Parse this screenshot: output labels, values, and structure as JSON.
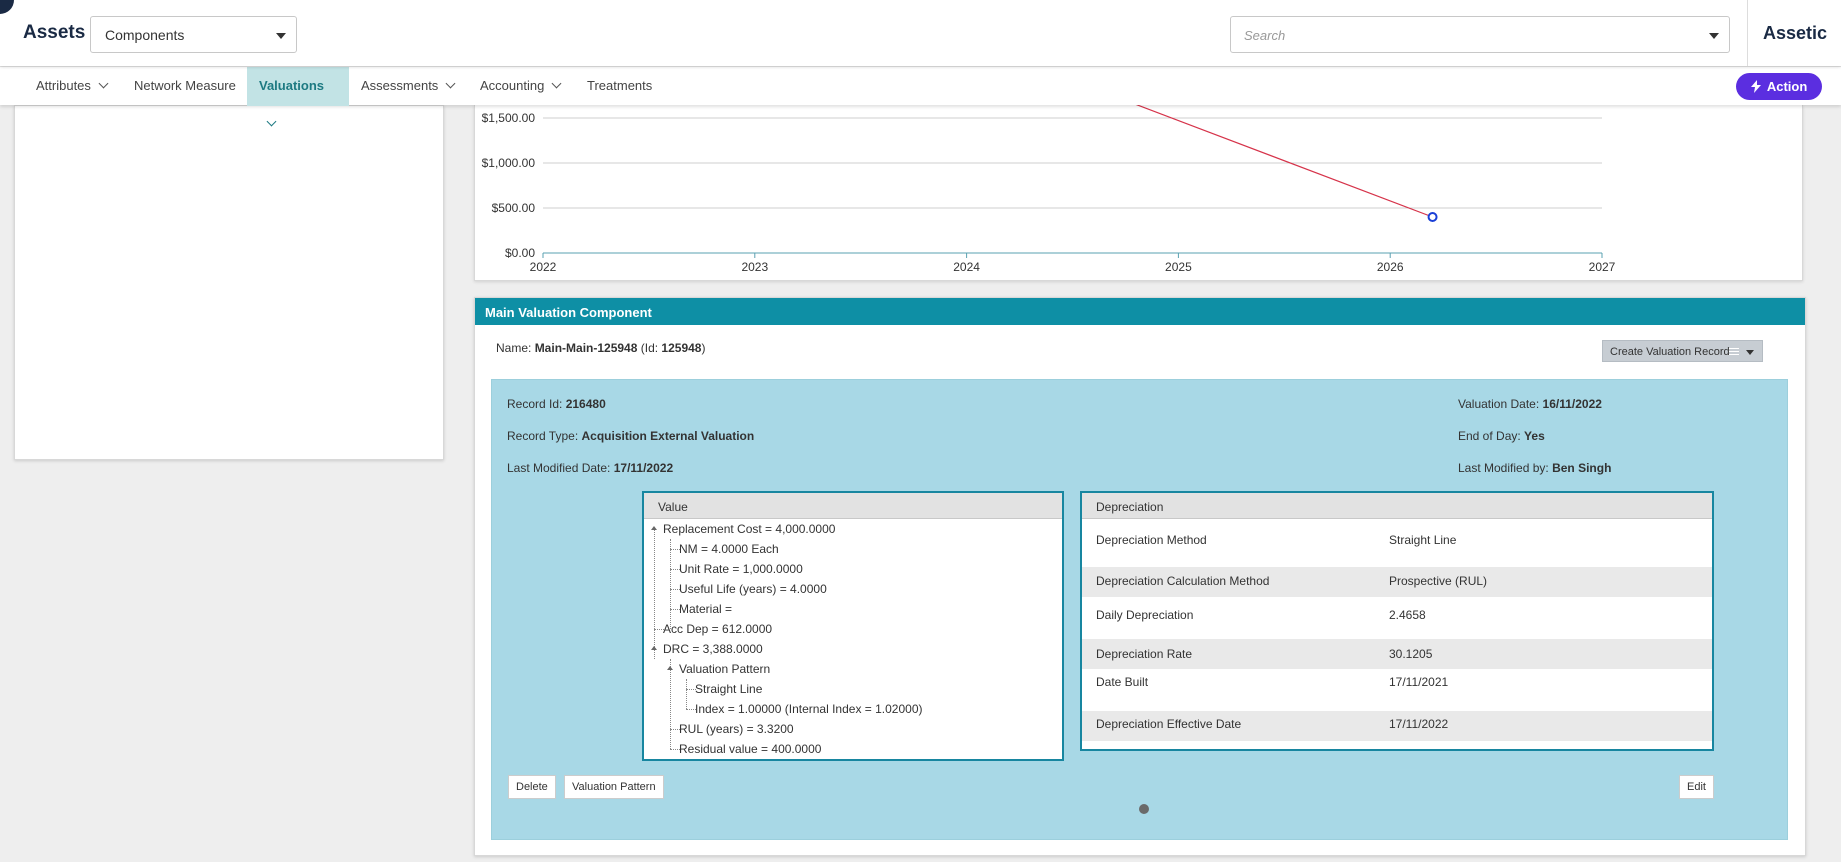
{
  "header": {
    "app_title": "Assets",
    "module_select": "Components",
    "search_placeholder": "Search",
    "brand": "Assetic"
  },
  "nav": {
    "items": [
      {
        "label": "Attributes",
        "has_dropdown": true,
        "active": false
      },
      {
        "label": "Network Measure",
        "has_dropdown": false,
        "active": false
      },
      {
        "label": "Valuations",
        "has_dropdown": true,
        "active": true
      },
      {
        "label": "Assessments",
        "has_dropdown": true,
        "active": false
      },
      {
        "label": "Accounting",
        "has_dropdown": true,
        "active": false
      },
      {
        "label": "Treatments",
        "has_dropdown": false,
        "active": false
      }
    ],
    "action_label": "Action"
  },
  "chart_data": {
    "type": "line",
    "title": "",
    "xlabel": "",
    "ylabel": "",
    "x_ticks": [
      "2022",
      "2023",
      "2024",
      "2025",
      "2026",
      "2027"
    ],
    "y_ticks": [
      "$0.00",
      "$500.00",
      "$1,000.00",
      "$1,500.00"
    ],
    "xlim": [
      2022,
      2027
    ],
    "series": [
      {
        "x": [
          2024.8,
          2026.2
        ],
        "y": [
          1650,
          400
        ],
        "color": "#d6334a",
        "marker_last": true,
        "marker_color": "#1a3fd6"
      }
    ],
    "grid": true
  },
  "mvc": {
    "title": "Main Valuation Component",
    "name_label": "Name:",
    "name_value": "Main-Main-125948",
    "id_label": "(Id:",
    "id_value": "125948",
    "id_close": ")",
    "create_button": "Create Valuation Record",
    "record": {
      "record_id_label": "Record Id:",
      "record_id": "216480",
      "record_type_label": "Record Type:",
      "record_type": "Acquisition External Valuation",
      "last_modified_date_label": "Last Modified Date:",
      "last_modified_date": "17/11/2022",
      "valuation_date_label": "Valuation Date:",
      "valuation_date": "16/11/2022",
      "end_of_day_label": "End of Day:",
      "end_of_day": "Yes",
      "last_modified_by_label": "Last Modified by:",
      "last_modified_by": "Ben Singh"
    },
    "value_box": {
      "title": "Value",
      "tree": [
        "Replacement Cost = 4,000.0000",
        "NM = 4.0000 Each",
        "Unit Rate = 1,000.0000",
        "Useful Life (years) = 4.0000",
        "Material =",
        "Acc Dep = 612.0000",
        "DRC = 3,388.0000",
        "Valuation Pattern",
        "Straight Line",
        "Index = 1.00000 (Internal Index = 1.02000)",
        "RUL (years) = 3.3200",
        "Residual value = 400.0000"
      ]
    },
    "depreciation_box": {
      "title": "Depreciation",
      "rows": [
        {
          "label": "Depreciation Method",
          "value": "Straight Line"
        },
        {
          "label": "Depreciation Calculation Method",
          "value": "Prospective (RUL)"
        },
        {
          "label": "Daily Depreciation",
          "value": "2.4658"
        },
        {
          "label": "Depreciation Rate",
          "value": "30.1205"
        },
        {
          "label": "Date Built",
          "value": "17/11/2021"
        },
        {
          "label": "Depreciation Effective Date",
          "value": "17/11/2022"
        }
      ]
    },
    "buttons": {
      "delete": "Delete",
      "valuation_pattern": "Valuation Pattern",
      "edit": "Edit"
    }
  }
}
